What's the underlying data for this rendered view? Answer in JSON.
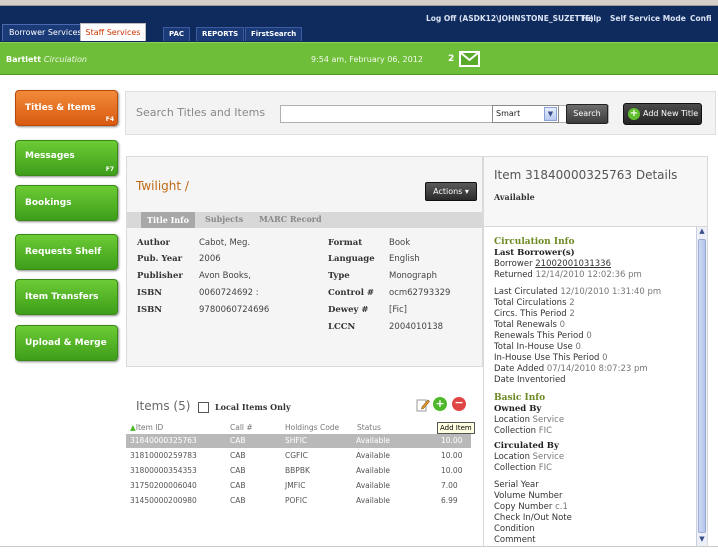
{
  "top_nav": {
    "tabs": [
      "Borrower Services",
      "Staff Services",
      "PAC",
      "REPORTS",
      "FirstSearch"
    ],
    "active_tab": "Staff Services",
    "links": [
      "Log Off (ASDK12\\JOHNSTONE_SUZETTE)",
      "Help",
      "Self Service Mode",
      "Confi"
    ]
  },
  "greenbar": {
    "library": "Bartlett",
    "module": "Circulation",
    "clock": "9:54 am, February 06, 2012",
    "message_count": "2"
  },
  "sidebar": [
    {
      "label": "Titles & Items",
      "key": "F4",
      "active": true
    },
    {
      "label": "Messages",
      "key": "F7",
      "active": false
    },
    {
      "label": "Bookings",
      "key": "",
      "active": false
    },
    {
      "label": "Requests Shelf",
      "key": "",
      "active": false
    },
    {
      "label": "Item Transfers",
      "key": "",
      "active": false
    },
    {
      "label": "Upload & Merge",
      "key": "",
      "active": false
    }
  ],
  "search": {
    "label": "Search Titles and Items",
    "value": "",
    "mode": "Smart",
    "button": "Search",
    "add_title": "Add New Title"
  },
  "title": {
    "name": "Twilight /",
    "actions": "Actions ▾",
    "tabs": [
      "Title Info",
      "Subjects",
      "MARC Record"
    ],
    "active_tab": "Title Info",
    "left_fields": [
      {
        "label": "Author",
        "value": "Cabot, Meg."
      },
      {
        "label": "Pub. Year",
        "value": "2006"
      },
      {
        "label": "Publisher",
        "value": "Avon Books,"
      },
      {
        "label": "ISBN",
        "value": "0060724692 :"
      },
      {
        "label": "ISBN",
        "value": "9780060724696"
      }
    ],
    "right_fields": [
      {
        "label": "Format",
        "value": "Book"
      },
      {
        "label": "Language",
        "value": "English"
      },
      {
        "label": "Type",
        "value": "Monograph"
      },
      {
        "label": "Control #",
        "value": "ocm62793329"
      },
      {
        "label": "Dewey #",
        "value": "[Fic]"
      },
      {
        "label": "LCCN",
        "value": "2004010138"
      }
    ]
  },
  "items": {
    "heading": "Items (5)",
    "local_only_label": "Local Items Only",
    "tooltip": "Add Item",
    "columns": [
      "Item ID",
      "Call #",
      "Holdings Code",
      "Status"
    ],
    "rows": [
      {
        "id": "31840000325763",
        "call": "CAB",
        "code": "SHFIC",
        "status": "Available",
        "price": "10.00",
        "selected": true
      },
      {
        "id": "31810000259783",
        "call": "CAB",
        "code": "CGFIC",
        "status": "Available",
        "price": "10.00",
        "selected": false
      },
      {
        "id": "31800000354353",
        "call": "CAB",
        "code": "BBPBK",
        "status": "Available",
        "price": "10.00",
        "selected": false
      },
      {
        "id": "31750200006040",
        "call": "CAB",
        "code": "JMFIC",
        "status": "Available",
        "price": "7.00",
        "selected": false
      },
      {
        "id": "31450000200980",
        "call": "CAB",
        "code": "POFIC",
        "status": "Available",
        "price": "6.99",
        "selected": false
      }
    ]
  },
  "details": {
    "title": "Item 31840000325763 Details",
    "status": "Available",
    "circ_heading": "Circulation Info",
    "last_borrowers": "Last Borrower(s)",
    "borrower_label": "Borrower",
    "borrower_value": "21002001031336",
    "returned_label": "Returned",
    "returned_value": "12/14/2010 12:02:36 pm",
    "stats": [
      {
        "label": "Last Circulated",
        "value": "12/10/2010 1:31:40 pm"
      },
      {
        "label": "Total Circulations",
        "value": "2"
      },
      {
        "label": "Circs. This Period",
        "value": "2"
      },
      {
        "label": "Total Renewals",
        "value": "0"
      },
      {
        "label": "Renewals This Period",
        "value": "0"
      },
      {
        "label": "Total In-House Use",
        "value": "0"
      },
      {
        "label": "In-House Use This Period",
        "value": "0"
      },
      {
        "label": "Date Added",
        "value": "07/14/2010 8:07:23 pm"
      },
      {
        "label": "Date Inventoried",
        "value": ""
      }
    ],
    "basic_heading": "Basic Info",
    "owned_by": "Owned By",
    "owned_location": {
      "label": "Location",
      "value": "Service"
    },
    "owned_collection": {
      "label": "Collection",
      "value": "FIC"
    },
    "circulated_by": "Circulated By",
    "circ_location": {
      "label": "Location",
      "value": "Service"
    },
    "circ_collection": {
      "label": "Collection",
      "value": "FIC"
    },
    "extra": [
      {
        "label": "Serial Year",
        "value": ""
      },
      {
        "label": "Volume Number",
        "value": ""
      },
      {
        "label": "Copy Number",
        "value": "c.1"
      },
      {
        "label": "Check In/Out Note",
        "value": ""
      },
      {
        "label": "Condition",
        "value": ""
      },
      {
        "label": "Comment",
        "value": ""
      }
    ]
  },
  "colors": {
    "nav_bg": "#0f2a5c",
    "green": "#6fbe3a",
    "orange": "#e8701f",
    "title_orange": "#c06a14",
    "section_green": "#6d8a22"
  }
}
